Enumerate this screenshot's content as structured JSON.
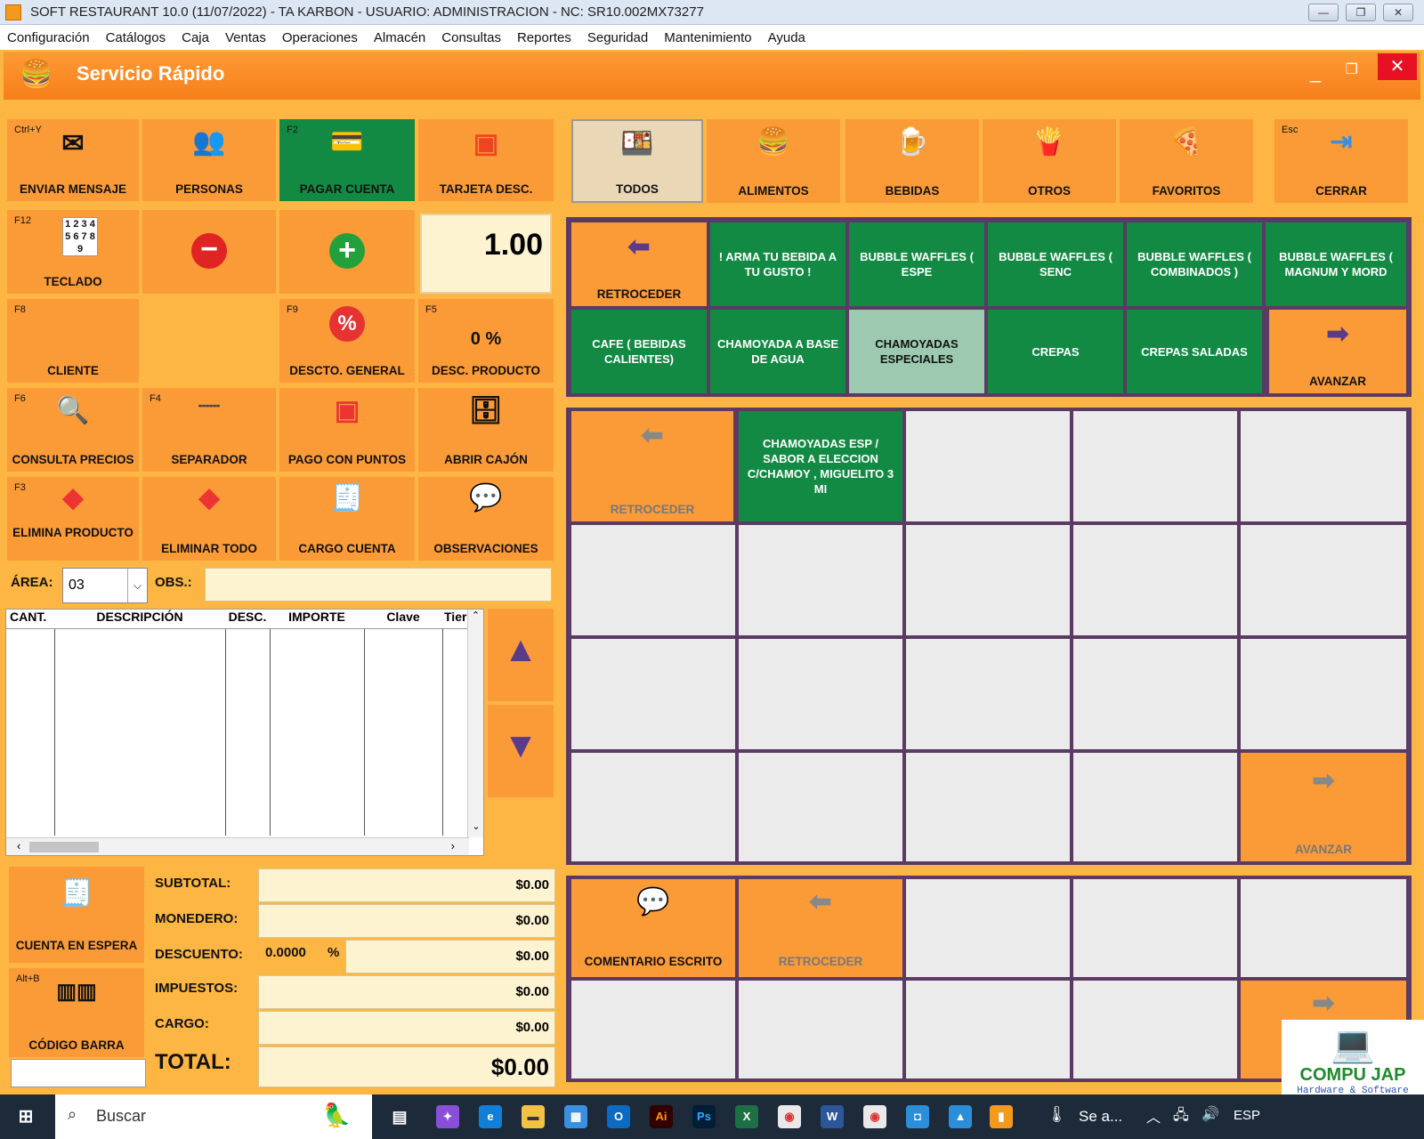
{
  "window": {
    "title": "SOFT RESTAURANT 10.0 (11/07/2022) -  TA KARBON  -  USUARIO: ADMINISTRACION   -   NC: SR10.002MX73277"
  },
  "menu": [
    "Configuración",
    "Catálogos",
    "Caja",
    "Ventas",
    "Operaciones",
    "Almacén",
    "Consultas",
    "Reportes",
    "Seguridad",
    "Mantenimiento",
    "Ayuda"
  ],
  "header": {
    "title": "Servicio Rápido"
  },
  "left_tiles": {
    "enviar": {
      "key": "Ctrl+Y",
      "label": "ENVIAR MENSAJE"
    },
    "personas": {
      "label": "PERSONAS"
    },
    "pagar": {
      "key": "F2",
      "label": "PAGAR CUENTA"
    },
    "tarjeta": {
      "label": "TARJETA DESC."
    },
    "teclado": {
      "key": "F12",
      "label": "TECLADO",
      "pad": "1 2 3 4 5 6 7 8 9"
    },
    "qty": "1.00",
    "cliente": {
      "key": "F8",
      "label": "CLIENTE"
    },
    "descto_general": {
      "key": "F9",
      "label": "DESCTO. GENERAL"
    },
    "desc_producto": {
      "key": "F5",
      "label": "DESC. PRODUCTO",
      "value": "0 %"
    },
    "consulta": {
      "key": "F6",
      "label": "CONSULTA PRECIOS"
    },
    "separador": {
      "key": "F4",
      "label": "SEPARADOR"
    },
    "pago_puntos": {
      "label": "PAGO CON PUNTOS"
    },
    "abrir_cajon": {
      "label": "ABRIR CAJÓN"
    },
    "elimina_producto": {
      "key": "F3",
      "label": "ELIMINA PRODUCTO"
    },
    "eliminar_todo": {
      "label": "ELIMINAR TODO"
    },
    "cargo_cuenta": {
      "label": "CARGO CUENTA"
    },
    "observaciones": {
      "label": "OBSERVACIONES"
    }
  },
  "area": {
    "label": "ÁREA:",
    "value": "03",
    "obs_label": "OBS.:"
  },
  "table": {
    "columns": [
      "CANT.",
      "DESCRIPCIÓN",
      "DESC.",
      "IMPORTE",
      "Clave",
      "Tier"
    ]
  },
  "bottom": {
    "cuenta_espera": "CUENTA EN ESPERA",
    "codigo_barra": {
      "key": "Alt+B",
      "label": "CÓDIGO BARRA"
    },
    "subtotal": {
      "label": "SUBTOTAL:",
      "value": "$0.00"
    },
    "monedero": {
      "label": "MONEDERO:",
      "value": "$0.00"
    },
    "descuento": {
      "label": "DESCUENTO:",
      "pct": "0.0000",
      "pct_sign": "%",
      "value": "$0.00"
    },
    "impuestos": {
      "label": "IMPUESTOS:",
      "value": "$0.00"
    },
    "cargo": {
      "label": "CARGO:",
      "value": "$0.00"
    },
    "total": {
      "label": "TOTAL:",
      "value": "$0.00"
    }
  },
  "categories": {
    "esc": "Esc",
    "items": [
      "TODOS",
      "ALIMENTOS",
      "BEBIDAS",
      "OTROS",
      "FAVORITOS",
      "CERRAR"
    ]
  },
  "groups": {
    "retroceder": "RETROCEDER",
    "avanzar": "AVANZAR",
    "items": [
      "! ARMA TU  BEBIDA A TU GUSTO !",
      "BUBBLE WAFFLES ( ESPE",
      "BUBBLE WAFFLES ( SENC",
      "BUBBLE WAFFLES ( COMBINADOS )",
      "BUBBLE WAFFLES ( MAGNUM Y MORD",
      "CAFE ( BEBIDAS CALIENTES)",
      "CHAMOYADA A BASE DE AGUA",
      "CHAMOYADAS ESPECIALES",
      "CREPAS",
      "CREPAS SALADAS"
    ]
  },
  "products": {
    "retroceder": "RETROCEDER",
    "avanzar": "AVANZAR",
    "items": [
      "CHAMOYADAS ESP / SABOR A ELECCION C/CHAMOY , MIGUELITO 3 MI"
    ]
  },
  "modifiers": {
    "comentario": "COMENTARIO ESCRITO",
    "retroceder": "RETROCEDER"
  },
  "logo": {
    "name": "COMPU JAP",
    "sub": "Hardware  &  Software"
  },
  "taskbar": {
    "search": "Buscar",
    "weather": "Se a...",
    "lang": "ESP"
  },
  "colors": {
    "orange": "#fb9b38",
    "green": "#138a44",
    "panel": "#5b3a63"
  }
}
